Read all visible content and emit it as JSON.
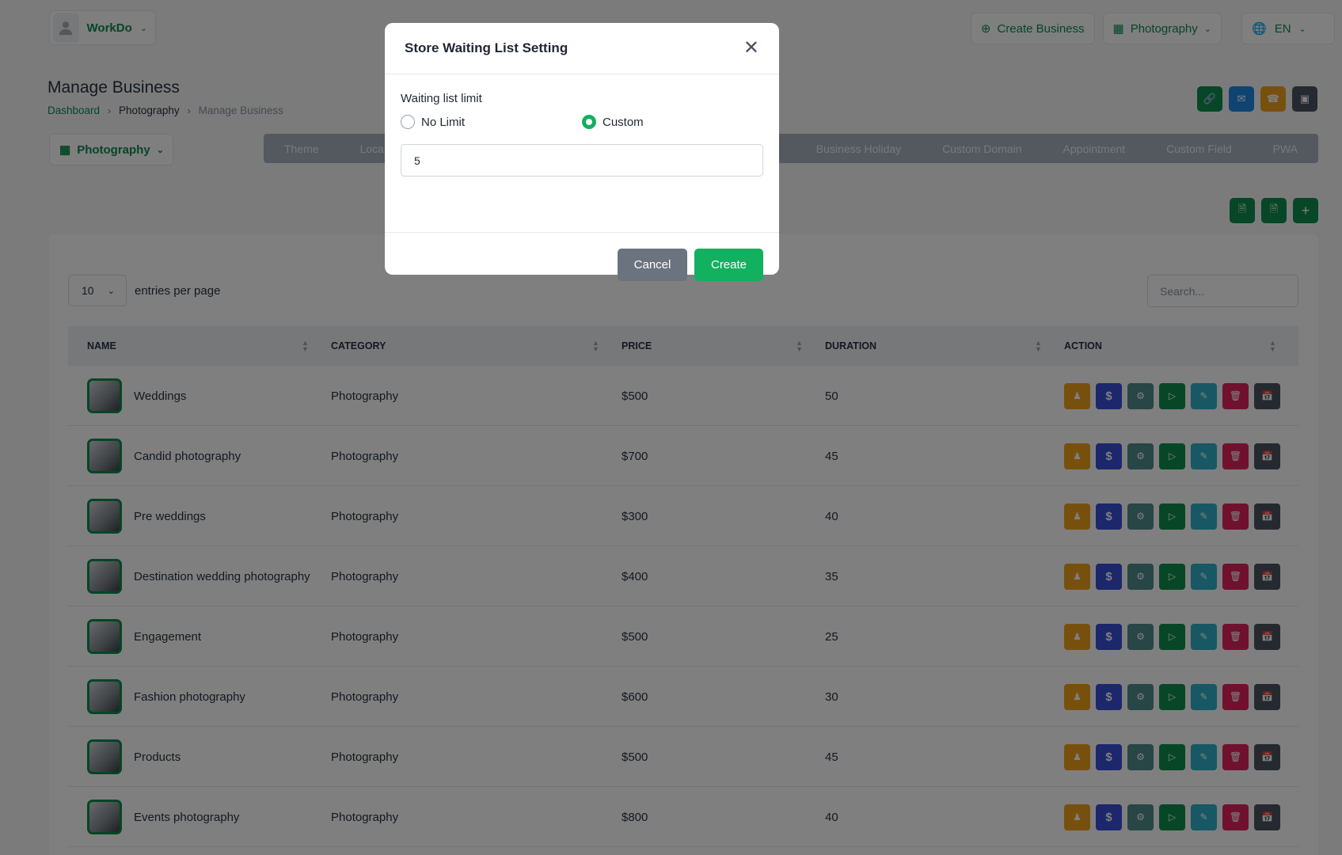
{
  "topbar": {
    "user_name": "WorkDo",
    "create_business": "Create Business",
    "business_select": "Photography",
    "language": "EN"
  },
  "page": {
    "title": "Manage Business",
    "breadcrumb": [
      "Dashboard",
      "Photography",
      "Manage Business"
    ]
  },
  "category_select": "Photography",
  "tabs": [
    "Theme",
    "Loca",
    "Business Holiday",
    "Custom Domain",
    "Appointment",
    "Custom Field",
    "PWA"
  ],
  "table": {
    "entries_value": "10",
    "entries_label": "entries per page",
    "search_placeholder": "Search...",
    "headers": [
      "NAME",
      "CATEGORY",
      "PRICE",
      "DURATION",
      "ACTION"
    ],
    "rows": [
      {
        "name": "Weddings",
        "category": "Photography",
        "price": "$500",
        "duration": "50"
      },
      {
        "name": "Candid photography",
        "category": "Photography",
        "price": "$700",
        "duration": "45"
      },
      {
        "name": "Pre weddings",
        "category": "Photography",
        "price": "$300",
        "duration": "40"
      },
      {
        "name": "Destination wedding photography",
        "category": "Photography",
        "price": "$400",
        "duration": "35"
      },
      {
        "name": "Engagement",
        "category": "Photography",
        "price": "$500",
        "duration": "25"
      },
      {
        "name": "Fashion photography",
        "category": "Photography",
        "price": "$600",
        "duration": "30"
      },
      {
        "name": "Products",
        "category": "Photography",
        "price": "$500",
        "duration": "45"
      },
      {
        "name": "Events photography",
        "category": "Photography",
        "price": "$800",
        "duration": "40"
      }
    ]
  },
  "modal": {
    "title": "Store Waiting List Setting",
    "field_label": "Waiting list limit",
    "option_no_limit": "No Limit",
    "option_custom": "Custom",
    "selected": "Custom",
    "limit_value": "5",
    "cancel_label": "Cancel",
    "create_label": "Create"
  },
  "colors": {
    "brand_green": "#0c8a4f",
    "create_green": "#13b05f",
    "action_orange": "#f0a01c",
    "action_blue": "#3b4ed8",
    "action_teal": "#4e8c8a",
    "action_green": "#0f8f4f",
    "action_cyan": "#2fb1c9",
    "action_red": "#e0245e",
    "action_dark": "#4a5260"
  }
}
